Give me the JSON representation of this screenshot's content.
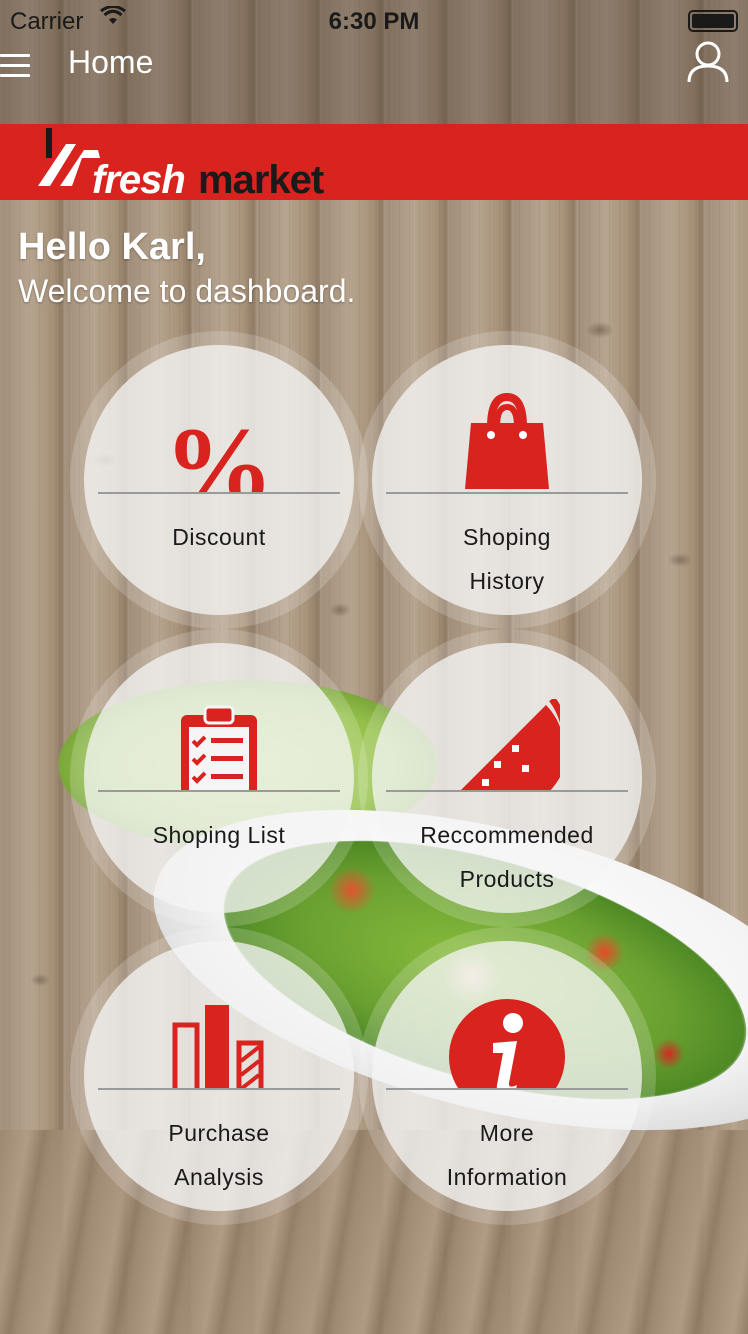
{
  "status_bar": {
    "carrier": "Carrier",
    "time": "6:30 PM"
  },
  "nav": {
    "title": "Home"
  },
  "brand": {
    "fresh": "fresh",
    "market": "market",
    "banner_color": "#d8231f"
  },
  "greeting": {
    "hello": "Hello Karl,",
    "welcome": "Welcome to dashboard."
  },
  "tiles": [
    {
      "label_line1": "Discount",
      "label_line2": "",
      "icon": "percent-icon"
    },
    {
      "label_line1": "Shoping",
      "label_line2": "History",
      "icon": "shopping-bag-icon"
    },
    {
      "label_line1": "Shoping List",
      "label_line2": "",
      "icon": "clipboard-checklist-icon"
    },
    {
      "label_line1": "Reccommended",
      "label_line2": "Products",
      "icon": "watermelon-icon"
    },
    {
      "label_line1": "Purchase",
      "label_line2": "Analysis",
      "icon": "bar-chart-icon"
    },
    {
      "label_line1": "More",
      "label_line2": "Information",
      "icon": "info-icon"
    }
  ],
  "colors": {
    "accent": "#d8231f",
    "tile_text": "#1a1a1a"
  }
}
